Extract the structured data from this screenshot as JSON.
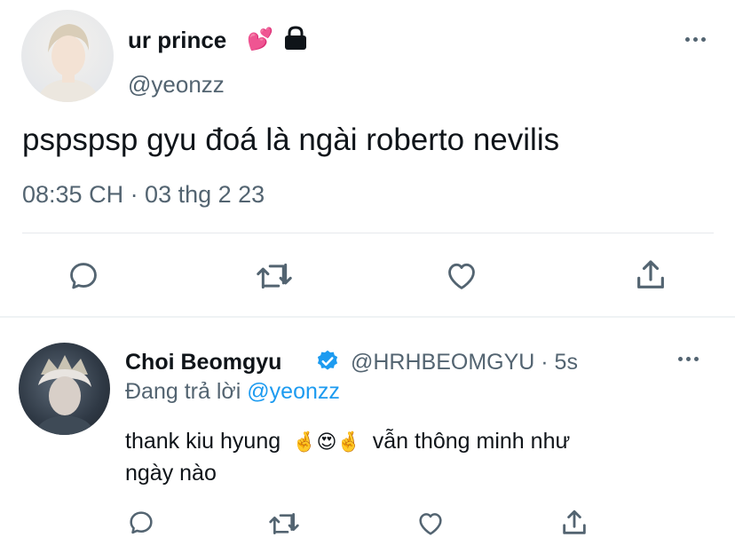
{
  "tweet": {
    "display_name": "ur prince",
    "name_emoji": "💕",
    "lock_icon": "lock-icon",
    "handle": "@yeonzz",
    "text": "pspspsp gyu đoá là ngài roberto nevilis",
    "timestamp": "08:35 CH · 03 thg 2 23",
    "actions": [
      "reply-icon",
      "retweet-icon",
      "like-icon",
      "share-icon"
    ]
  },
  "reply": {
    "display_name": "Choi Beomgyu",
    "verified_icon": "verified-badge-icon",
    "handle_time": "@HRHBEOMGYU · 5s",
    "replying_prefix": "Đang trả lời",
    "replying_to": "@yeonzz",
    "text_line1_a": "thank kiu hyung",
    "emojis": "🤞😍🤞",
    "text_line1_b": "vẫn thông minh như",
    "text_line2": "ngày nào",
    "actions": [
      "reply-icon",
      "retweet-icon",
      "like-icon",
      "share-icon"
    ]
  },
  "colors": {
    "accent": "#1d9bf0",
    "muted": "#536471",
    "text": "#0f1419"
  }
}
